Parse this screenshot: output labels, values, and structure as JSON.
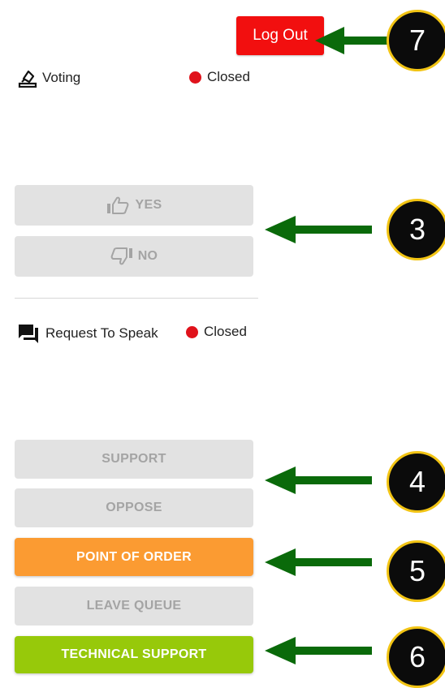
{
  "header": {
    "logout_label": "Log Out"
  },
  "voting": {
    "label": "Voting",
    "icon": "ballot-box-icon",
    "status_text": "Closed",
    "status_color": "#e0121b",
    "yes_label": "YES",
    "no_label": "NO"
  },
  "speak": {
    "label": "Request To Speak",
    "icon": "chat-bubble-icon",
    "status_text": "Closed",
    "status_color": "#e0121b"
  },
  "actions": {
    "support_label": "SUPPORT",
    "oppose_label": "OPPOSE",
    "point_of_order_label": "POINT OF ORDER",
    "leave_queue_label": "LEAVE QUEUE",
    "technical_support_label": "TECHNICAL SUPPORT"
  },
  "callouts": {
    "logout": "7",
    "vote_buttons": "3",
    "support_oppose": "4",
    "point_of_order": "5",
    "technical_support": "6"
  },
  "colors": {
    "logout": "#f20f0f",
    "orange": "#fb9b32",
    "green": "#97c90a",
    "disabled_bg": "#e2e2e2",
    "disabled_text": "#a4a4a4",
    "arrow": "#0a6a0a",
    "badge_ring": "#f2c414"
  }
}
